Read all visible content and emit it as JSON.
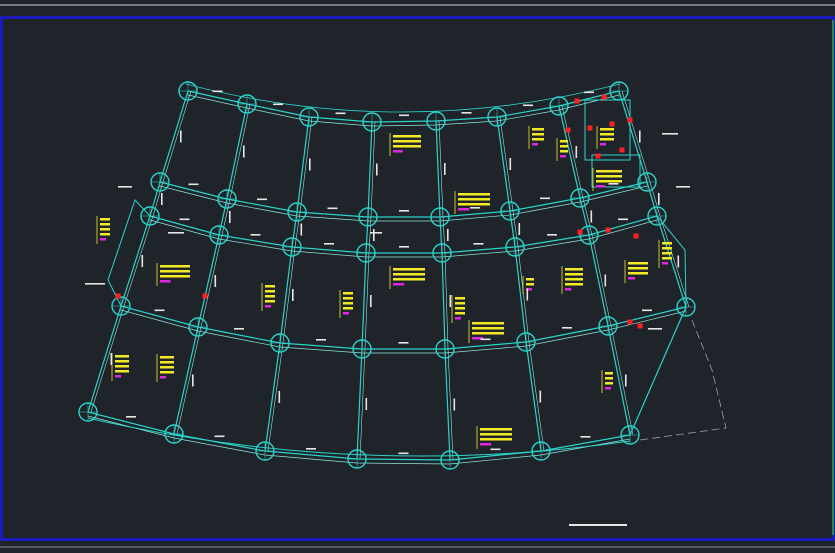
{
  "viewport": {
    "background": "#1f242b",
    "frame_color": "#1a1ad6",
    "top_line_color": "#cfd3d8",
    "right_edge_color": "#1fae3a"
  },
  "colors": {
    "grid_line": "#2bd3c9",
    "column": "#2bd3c9",
    "beam_inner": "#8fe7df",
    "dim_text": "#e6e6e6",
    "note_yellow": "#f3ea24",
    "note_magenta": "#e126e1",
    "red_marker": "#ff2020",
    "dashed_line": "#9aa0a6",
    "scale_bar": "#e6e6e6"
  },
  "icons": {
    "column_marker": "circle-column-icon",
    "red_marker": "red-square-marker-icon",
    "scale_bar": "scale-bar-icon"
  }
}
